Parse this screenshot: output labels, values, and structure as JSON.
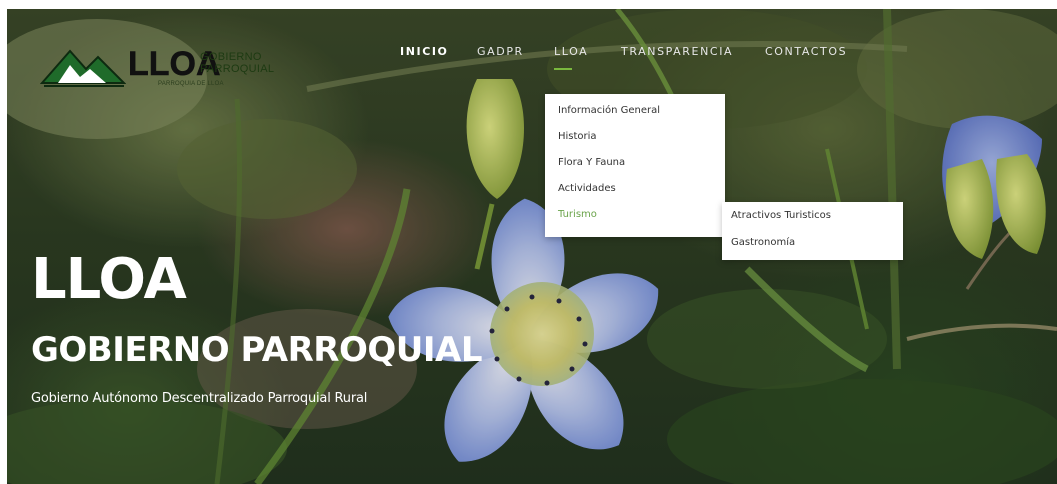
{
  "header": {
    "logo": {
      "word": "LLOA",
      "subtitle_line1": "GOBIERNO",
      "subtitle_line2": "PARROQUIAL",
      "tagline": "PARROQUIA DE LLOA"
    },
    "nav": [
      {
        "label": "INICIO",
        "active": true
      },
      {
        "label": "GADPR",
        "active": false
      },
      {
        "label": "LLOA",
        "active": false,
        "open": true
      },
      {
        "label": "TRANSPARENCIA",
        "active": false
      },
      {
        "label": "CONTACTOS",
        "active": false
      }
    ]
  },
  "dropdown": {
    "items": [
      {
        "label": "Información General"
      },
      {
        "label": "Historia"
      },
      {
        "label": "Flora Y Fauna"
      },
      {
        "label": "Actividades"
      },
      {
        "label": "Turismo",
        "highlighted": true
      }
    ],
    "submenu": {
      "parent": "Turismo",
      "items": [
        {
          "label": "Atractivos Turisticos"
        },
        {
          "label": "Gastronomía"
        }
      ]
    }
  },
  "hero": {
    "title": "LLOA",
    "subtitle": "GOBIERNO PARROQUIAL",
    "description": "Gobierno Autónomo Descentralizado Parroquial Rural"
  },
  "colors": {
    "accent": "#7ab83e",
    "menu_highlight": "#6aa34a",
    "menu_text": "#333333"
  }
}
